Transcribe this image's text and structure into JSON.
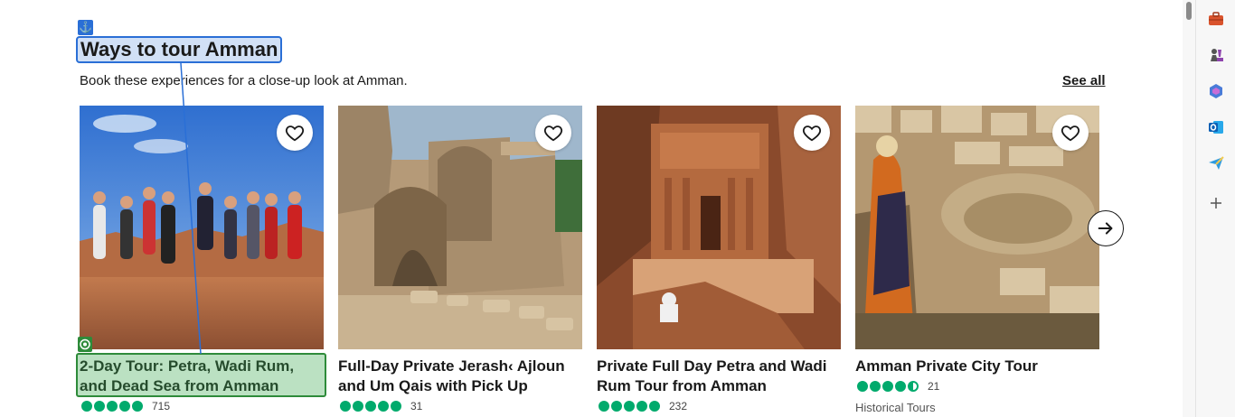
{
  "section": {
    "title": "Ways to tour Amman",
    "subtitle": "Book these experiences for a close-up look at Amman.",
    "see_all_label": "See all"
  },
  "cards": [
    {
      "title": "2-Day Tour: Petra, Wadi Rum, and Dead Sea from Amman",
      "rating": 5,
      "review_count": "715",
      "category": ""
    },
    {
      "title": "Full-Day Private Jerash‹ Ajloun and Um Qais with Pick Up",
      "rating": 5,
      "review_count": "31",
      "category": ""
    },
    {
      "title": "Private Full Day Petra and Wadi Rum Tour from Amman",
      "rating": 5,
      "review_count": "232",
      "category": ""
    },
    {
      "title": "Amman Private City Tour",
      "rating": 4.5,
      "review_count": "21",
      "category": "Historical Tours"
    }
  ],
  "icons": {
    "anchor": "⚓",
    "heart": "heart-icon",
    "next": "arrow-right-icon",
    "rail": [
      "briefcase-icon",
      "chess-icon",
      "copilot-icon",
      "outlook-icon",
      "send-icon",
      "plus-icon"
    ]
  },
  "colors": {
    "rating_green": "#00aa6c",
    "highlight_blue": "#2a6fd6",
    "highlight_green": "#2e8b3a"
  }
}
